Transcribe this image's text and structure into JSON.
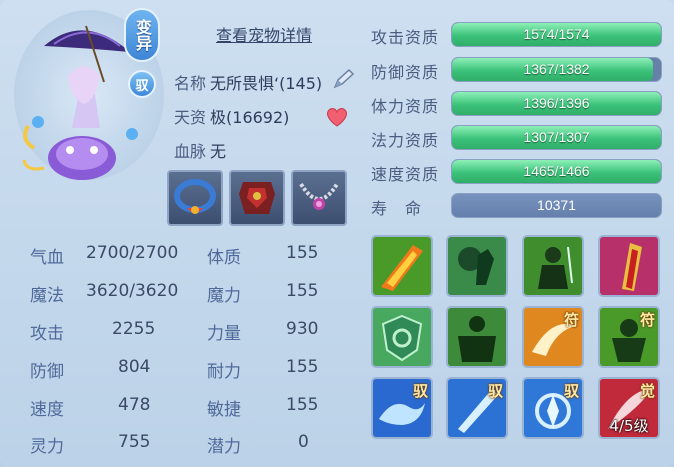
{
  "header": {
    "mutant_badge": "变异",
    "ride_badge": "驭",
    "detail_link": "查看宠物详情"
  },
  "info": {
    "name_label": "名称",
    "name_value": "无所畏惧‘(145)",
    "talent_label": "天资",
    "talent_value": "极(16692)",
    "bloodline_label": "血脉",
    "bloodline_value": "无"
  },
  "stats": {
    "hp_label": "气血",
    "hp_value": "2700/2700",
    "mp_label": "魔法",
    "mp_value": "3620/3620",
    "atk_label": "攻击",
    "atk_value": "2255",
    "def_label": "防御",
    "def_value": "804",
    "spd_label": "速度",
    "spd_value": "478",
    "spi_label": "灵力",
    "spi_value": "755",
    "con_label": "体质",
    "con_value": "155",
    "mag_label": "魔力",
    "mag_value": "155",
    "str_label": "力量",
    "str_value": "930",
    "end_label": "耐力",
    "end_value": "155",
    "agi_label": "敏捷",
    "agi_value": "155",
    "pot_label": "潜力",
    "pot_value": "0"
  },
  "aptitudes": {
    "attack": {
      "label": "攻击资质",
      "text": "1574/1574",
      "fraction": 1.0
    },
    "defense": {
      "label": "防御资质",
      "text": "1367/1382",
      "fraction": 0.96
    },
    "stamina": {
      "label": "体力资质",
      "text": "1396/1396",
      "fraction": 1.0
    },
    "magic": {
      "label": "法力资质",
      "text": "1307/1307",
      "fraction": 1.0
    },
    "speed": {
      "label": "速度资质",
      "text": "1465/1466",
      "fraction": 0.999
    },
    "life": {
      "label": "寿　命",
      "text": "10371"
    }
  },
  "skills": {
    "tag_fu": "符",
    "tag_yu": "驭",
    "tag_jue": "觉",
    "level_text": "4/5级"
  },
  "colors": {
    "apt_fill": "#3cc27a",
    "apt_bg": "#6680a8",
    "badge_blue": "#3e86d6"
  }
}
